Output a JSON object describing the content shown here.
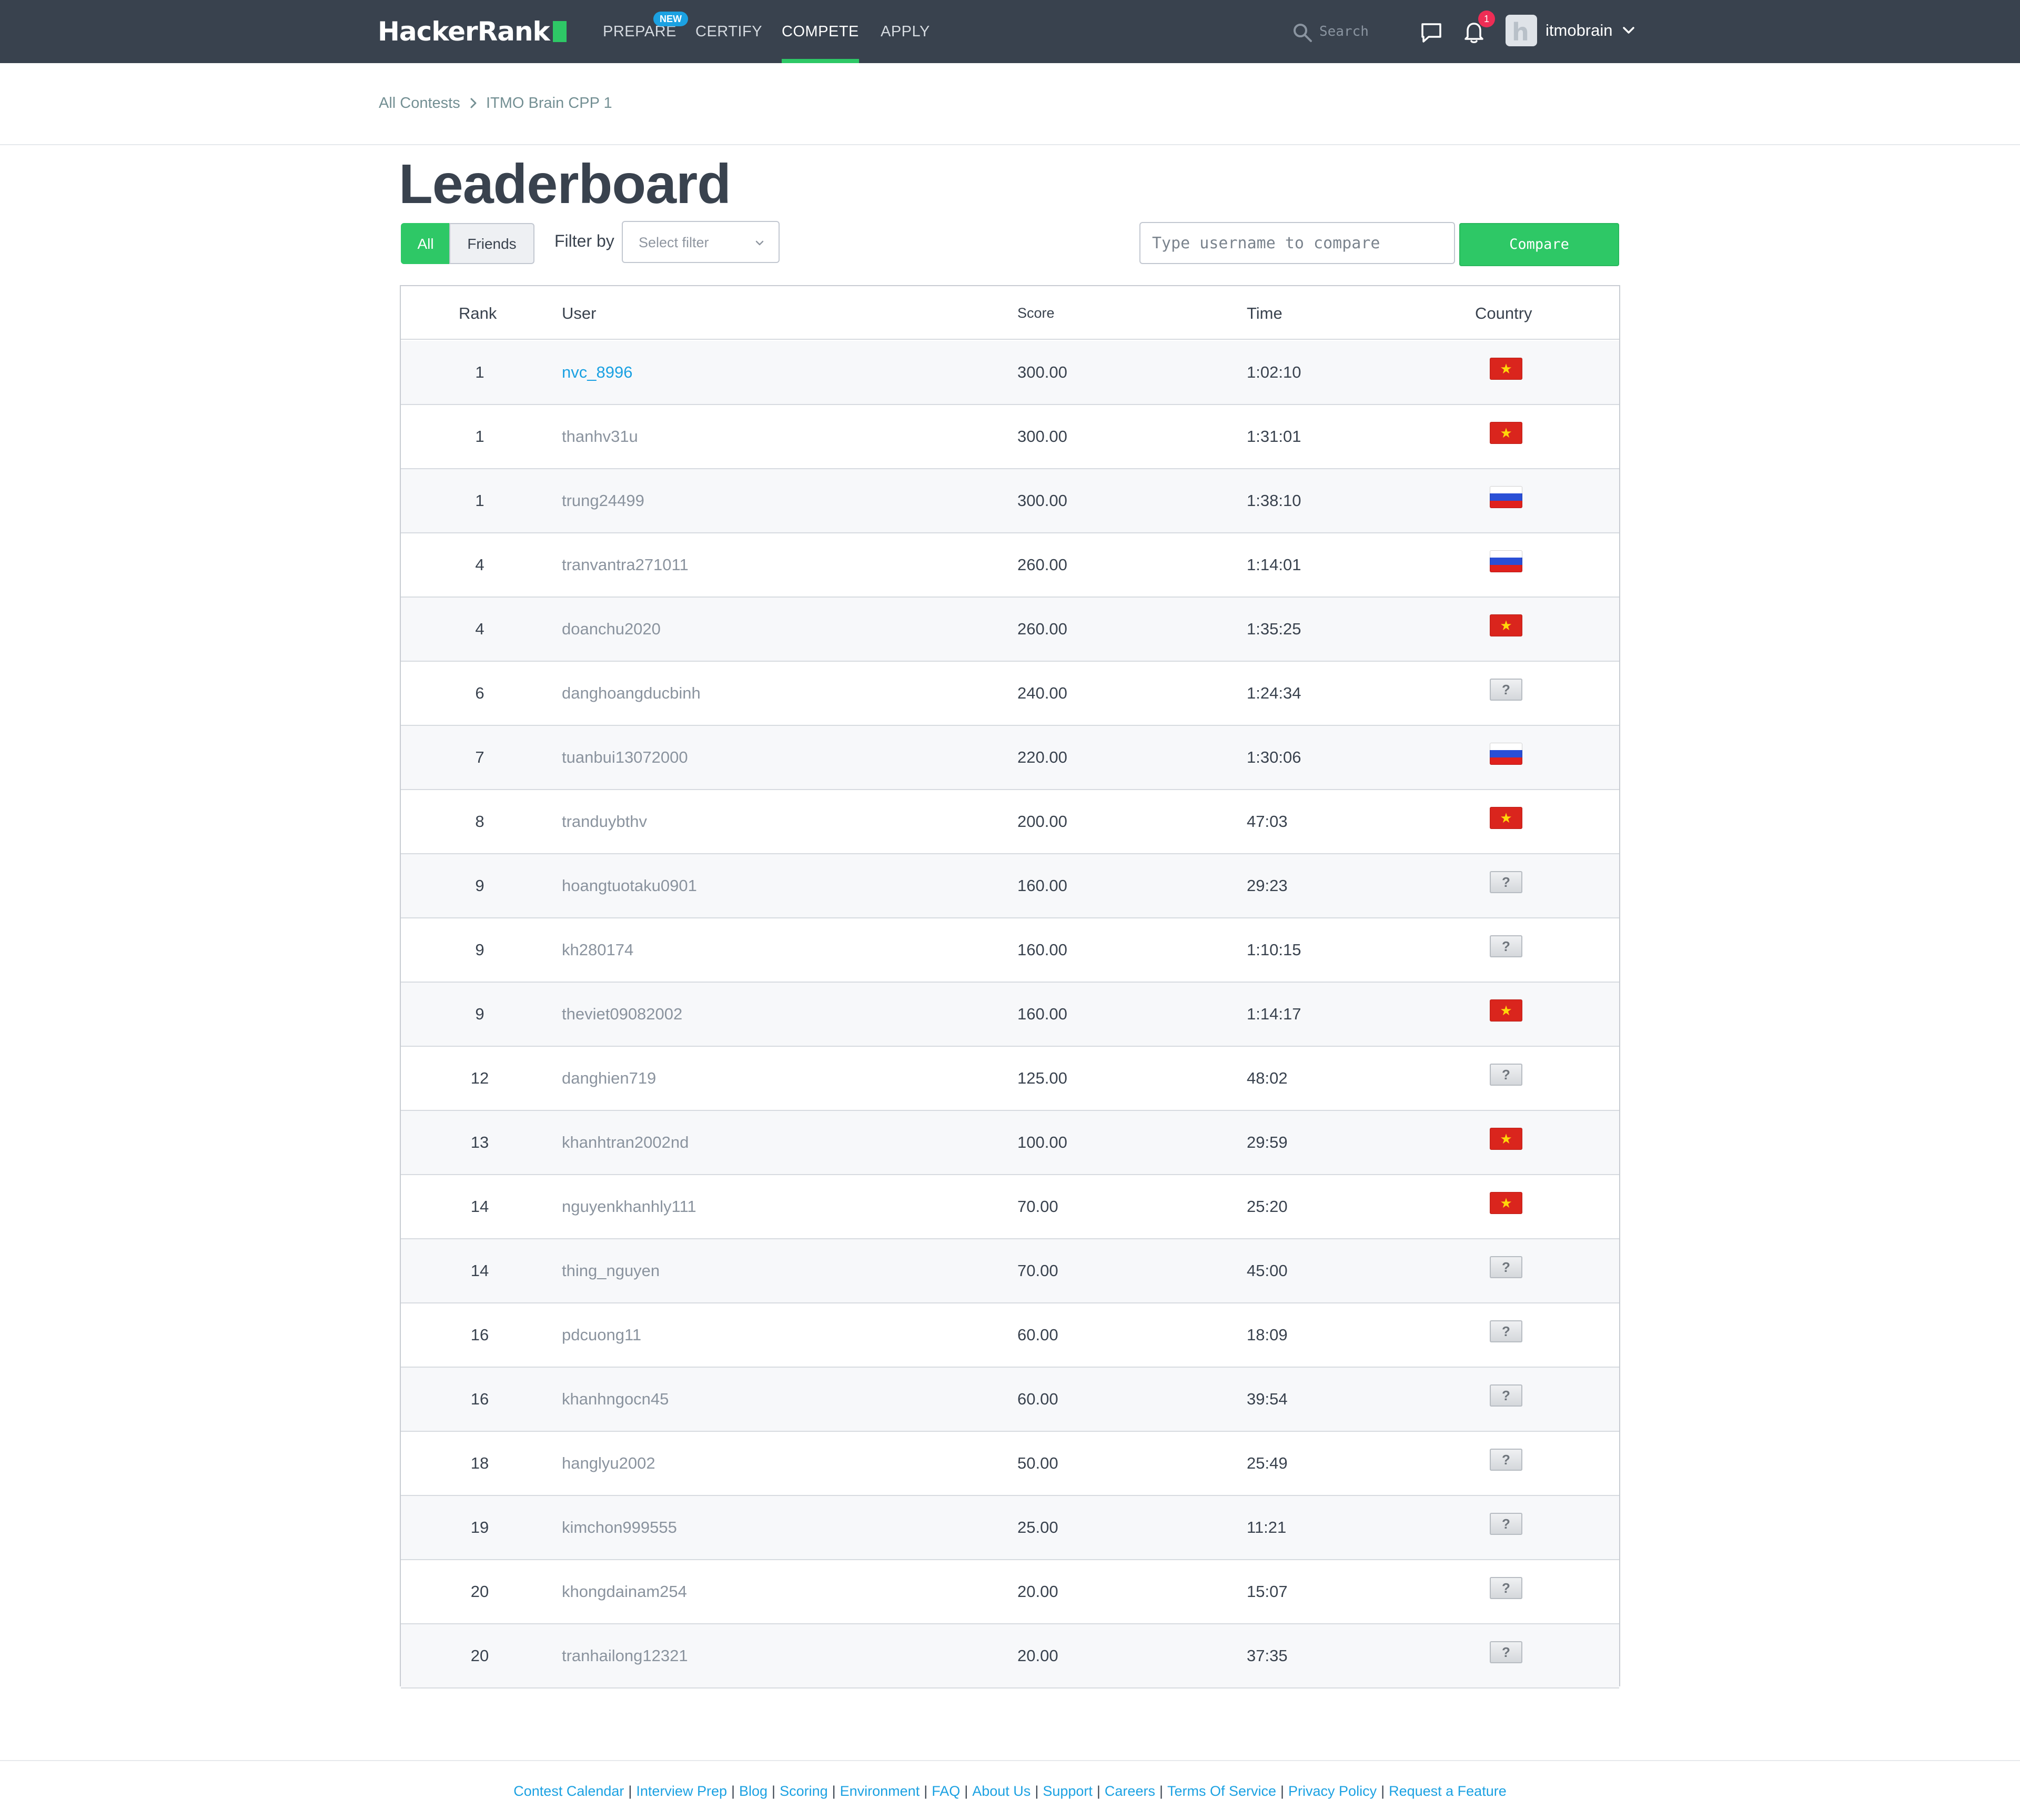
{
  "nav": {
    "logo": "HackerRank",
    "items": [
      {
        "label": "PREPARE"
      },
      {
        "label": "CERTIFY"
      },
      {
        "label": "COMPETE"
      },
      {
        "label": "APPLY"
      }
    ],
    "new_badge": "NEW",
    "search_placeholder": "Search",
    "notification_count": "1",
    "username": "itmobrain"
  },
  "breadcrumb": {
    "items": [
      {
        "label": "All Contests"
      },
      {
        "label": "ITMO Brain CPP 1"
      }
    ]
  },
  "page_title": "Leaderboard",
  "filters": {
    "all_label": "All",
    "friends_label": "Friends",
    "filter_label": "Filter by",
    "select_placeholder": "Select filter",
    "compare_placeholder": "Type username to compare",
    "compare_label": "Compare"
  },
  "table": {
    "columns": {
      "rank": "Rank",
      "user": "User",
      "score": "Score",
      "time": "Time",
      "country": "Country"
    },
    "rows": [
      {
        "rank": "1",
        "user": "nvc_8996",
        "score": "300.00",
        "time": "1:02:10",
        "country": "vietnam-flag-icon",
        "self": true
      },
      {
        "rank": "1",
        "user": "thanhv31u",
        "score": "300.00",
        "time": "1:31:01",
        "country": "vietnam-flag-icon"
      },
      {
        "rank": "1",
        "user": "trung24499",
        "score": "300.00",
        "time": "1:38:10",
        "country": "russia-flag-icon"
      },
      {
        "rank": "4",
        "user": "tranvantra271011",
        "score": "260.00",
        "time": "1:14:01",
        "country": "russia-flag-icon"
      },
      {
        "rank": "4",
        "user": "doanchu2020",
        "score": "260.00",
        "time": "1:35:25",
        "country": "vietnam-flag-icon"
      },
      {
        "rank": "6",
        "user": "danghoangducbinh",
        "score": "240.00",
        "time": "1:24:34",
        "country": "unknown-flag-icon"
      },
      {
        "rank": "7",
        "user": "tuanbui13072000",
        "score": "220.00",
        "time": "1:30:06",
        "country": "russia-flag-icon"
      },
      {
        "rank": "8",
        "user": "tranduybthv",
        "score": "200.00",
        "time": "47:03",
        "country": "vietnam-flag-icon"
      },
      {
        "rank": "9",
        "user": "hoangtuotaku0901",
        "score": "160.00",
        "time": "29:23",
        "country": "unknown-flag-icon"
      },
      {
        "rank": "9",
        "user": "kh280174",
        "score": "160.00",
        "time": "1:10:15",
        "country": "unknown-flag-icon"
      },
      {
        "rank": "9",
        "user": "theviet09082002",
        "score": "160.00",
        "time": "1:14:17",
        "country": "vietnam-flag-icon"
      },
      {
        "rank": "12",
        "user": "danghien719",
        "score": "125.00",
        "time": "48:02",
        "country": "unknown-flag-icon"
      },
      {
        "rank": "13",
        "user": "khanhtran2002nd",
        "score": "100.00",
        "time": "29:59",
        "country": "vietnam-flag-icon"
      },
      {
        "rank": "14",
        "user": "nguyenkhanhly111",
        "score": "70.00",
        "time": "25:20",
        "country": "vietnam-flag-icon"
      },
      {
        "rank": "14",
        "user": "thing_nguyen",
        "score": "70.00",
        "time": "45:00",
        "country": "unknown-flag-icon"
      },
      {
        "rank": "16",
        "user": "pdcuong11",
        "score": "60.00",
        "time": "18:09",
        "country": "unknown-flag-icon"
      },
      {
        "rank": "16",
        "user": "khanhngocn45",
        "score": "60.00",
        "time": "39:54",
        "country": "unknown-flag-icon"
      },
      {
        "rank": "18",
        "user": "hanglyu2002",
        "score": "50.00",
        "time": "25:49",
        "country": "unknown-flag-icon"
      },
      {
        "rank": "19",
        "user": "kimchon999555",
        "score": "25.00",
        "time": "11:21",
        "country": "unknown-flag-icon"
      },
      {
        "rank": "20",
        "user": "khongdainam254",
        "score": "20.00",
        "time": "15:07",
        "country": "unknown-flag-icon"
      },
      {
        "rank": "20",
        "user": "tranhailong12321",
        "score": "20.00",
        "time": "37:35",
        "country": "unknown-flag-icon"
      }
    ]
  },
  "footer": {
    "links": [
      {
        "label": "Contest Calendar"
      },
      {
        "label": "Interview Prep"
      },
      {
        "label": "Blog"
      },
      {
        "label": "Scoring"
      },
      {
        "label": "Environment"
      },
      {
        "label": "FAQ"
      },
      {
        "label": "About Us"
      },
      {
        "label": "Support"
      },
      {
        "label": "Careers"
      },
      {
        "label": "Terms Of Service"
      },
      {
        "label": "Privacy Policy"
      },
      {
        "label": "Request a Feature"
      }
    ]
  },
  "colors": {
    "nav_bg": "#39424e",
    "accent_green": "#2ec866",
    "link_blue": "#1ba1e2",
    "notification_red": "#ee2d55"
  }
}
